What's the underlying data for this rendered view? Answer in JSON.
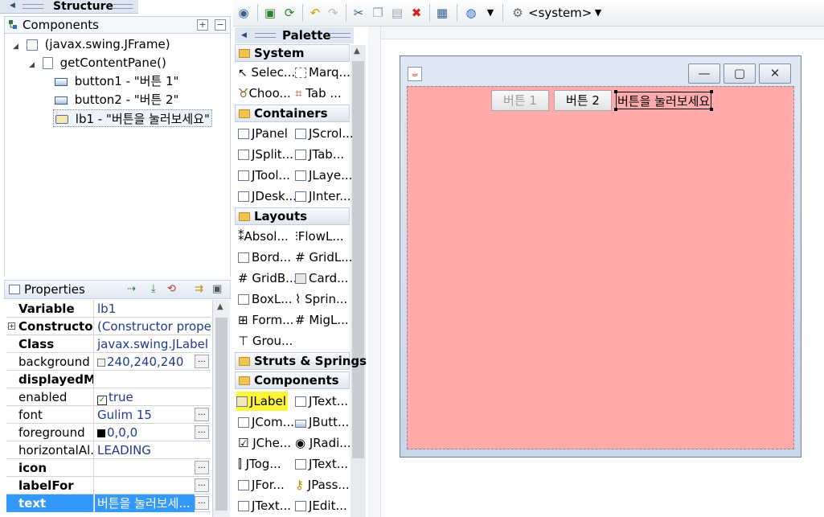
{
  "structure": {
    "title": "Structure",
    "components_label": "Components",
    "tree": [
      {
        "label": "(javax.swing.JFrame)",
        "icon": "frame-icon"
      },
      {
        "label": "getContentPane()",
        "icon": "panel-icon"
      },
      {
        "label": "button1 - \"버튼 1\"",
        "icon": "button-icon"
      },
      {
        "label": "button2 - \"버튼 2\"",
        "icon": "button-icon"
      },
      {
        "label": "lb1 - \"버튼을 눌러보세요\"",
        "icon": "label-icon"
      }
    ]
  },
  "properties": {
    "title": "Properties",
    "rows": [
      {
        "name": "Variable",
        "value": "lb1"
      },
      {
        "name": "Constructor",
        "value": "(Constructor prope..."
      },
      {
        "name": "Class",
        "value": "javax.swing.JLabel"
      },
      {
        "name": "background",
        "value": "240,240,240"
      },
      {
        "name": "displayedM...",
        "value": ""
      },
      {
        "name": "enabled",
        "value": "true"
      },
      {
        "name": "font",
        "value": "Gulim 15"
      },
      {
        "name": "foreground",
        "value": "0,0,0"
      },
      {
        "name": "horizontalAl...",
        "value": "LEADING"
      },
      {
        "name": "icon",
        "value": ""
      },
      {
        "name": "labelFor",
        "value": ""
      },
      {
        "name": "text",
        "value": "버튼을 눌러보세..."
      }
    ],
    "more_button": "..."
  },
  "toolbar": {
    "system_label": "<system>"
  },
  "palette": {
    "title": "Palette",
    "categories": {
      "system": "System",
      "containers": "Containers",
      "layouts": "Layouts",
      "struts": "Struts & Springs",
      "components": "Components"
    },
    "items": {
      "selection": "Selec...",
      "marquee": "Marq...",
      "choose": "Choo...",
      "taborder": "Tab ...",
      "jpanel": "JPanel",
      "jscroll": "JScrol...",
      "jsplit": "JSplit...",
      "jtab": "JTab...",
      "jtool": "JTool...",
      "jlayer": "JLaye...",
      "jdesk": "JDesk...",
      "jinter": "JInter...",
      "absolute": "Absol...",
      "flow": "FlowL...",
      "border": "Bord...",
      "grid": "GridL...",
      "gridbag": "GridB...",
      "card": "Card...",
      "box": "BoxL...",
      "spring": "Sprin...",
      "form": "Form...",
      "mig": "MigL...",
      "group": "Grou...",
      "jlabel": "JLabel",
      "jtextfield": "JText...",
      "jcombo": "JCom...",
      "jbutton": "JButt...",
      "jcheck": "JChe...",
      "jradio": "JRadi...",
      "jtoggle": "JTog...",
      "jtextarea": "JText...",
      "jformatted": "JFor...",
      "jpass": "JPass...",
      "jtextpane": "JText...",
      "jedit": "JEdit..."
    }
  },
  "design": {
    "button1": "버튼 1",
    "button2": "버튼 2",
    "label": "버튼을 눌러보세요",
    "content_color": "#ffabab",
    "highlight_color": "#fdf53a"
  }
}
